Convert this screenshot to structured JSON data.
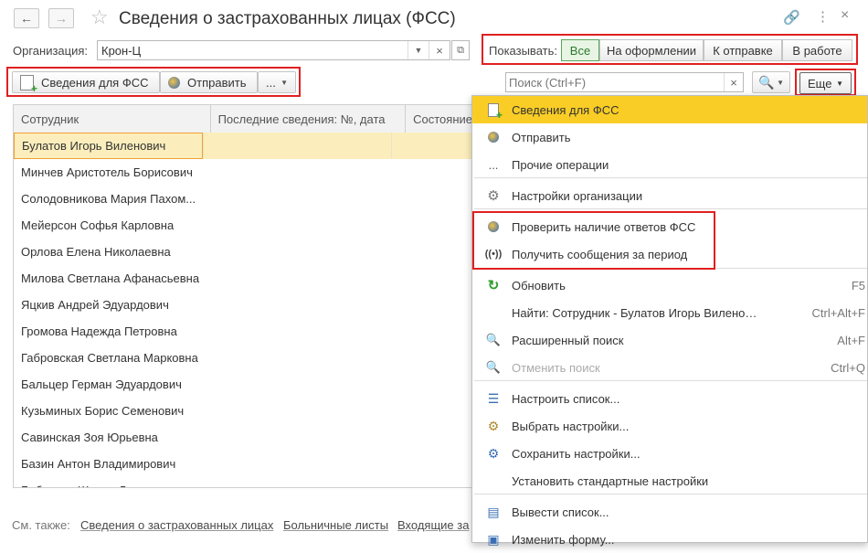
{
  "window": {
    "title": "Сведения о застрахованных лицах (ФСС)"
  },
  "org": {
    "label": "Организация:",
    "value": "Крон-Ц"
  },
  "show": {
    "label": "Показывать:",
    "options": [
      "Все",
      "На оформлении",
      "К отправке",
      "В работе"
    ],
    "active": "Все"
  },
  "toolbar": {
    "create_label": "Сведения для ФСС",
    "send_label": "Отправить",
    "more_label": "..."
  },
  "search": {
    "placeholder": "Поиск (Ctrl+F)",
    "clear": "×"
  },
  "more_button": {
    "label": "Еще"
  },
  "grid": {
    "headers": [
      "Сотрудник",
      "Последние сведения: №, дата",
      "Состояние"
    ],
    "rows": [
      "Булатов Игорь Виленович",
      "Минчев Аристотель Борисович",
      "Солодовникова Мария Пахом...",
      "Мейерсон Софья Карловна",
      "Орлова Елена Николаевна",
      "Милова Светлана Афанасьевна",
      "Яцкив Андрей Эдуардович",
      "Громова Надежда Петровна",
      "Габровская Светлана Марковна",
      "Бальцер Герман Эдуардович",
      "Кузьминых Борис Семенович",
      "Савинская Зоя Юрьевна",
      "Базин Антон Владимирович",
      "Бабичева Жанна Л..."
    ]
  },
  "menu": {
    "items": [
      {
        "label": "Сведения для ФСС",
        "icon": "add-doc-icon",
        "shortcut": ""
      },
      {
        "label": "Отправить",
        "icon": "send-globe-icon",
        "shortcut": ""
      },
      {
        "label": "Прочие операции",
        "icon": "ellipsis-icon",
        "shortcut": ""
      },
      {
        "label": "Настройки организации",
        "icon": "gear-icon",
        "shortcut": ""
      },
      {
        "label": "Проверить наличие ответов ФСС",
        "icon": "check-globe-icon",
        "shortcut": ""
      },
      {
        "label": "Получить сообщения за период",
        "icon": "broadcast-icon",
        "shortcut": ""
      },
      {
        "label": "Обновить",
        "icon": "refresh-icon",
        "shortcut": "F5"
      },
      {
        "label": "Найти: Сотрудник - Булатов Игорь Вилено…",
        "icon": "",
        "shortcut": "Ctrl+Alt+F"
      },
      {
        "label": "Расширенный поиск",
        "icon": "search-icon",
        "shortcut": "Alt+F"
      },
      {
        "label": "Отменить поиск",
        "icon": "cancel-search-icon",
        "shortcut": "Ctrl+Q"
      },
      {
        "label": "Настроить список...",
        "icon": "list-settings-icon",
        "shortcut": ""
      },
      {
        "label": "Выбрать настройки...",
        "icon": "choose-settings-icon",
        "shortcut": ""
      },
      {
        "label": "Сохранить настройки...",
        "icon": "save-settings-icon",
        "shortcut": ""
      },
      {
        "label": "Установить стандартные настройки",
        "icon": "",
        "shortcut": ""
      },
      {
        "label": "Вывести список...",
        "icon": "print-list-icon",
        "shortcut": ""
      },
      {
        "label": "Изменить форму...",
        "icon": "form-icon",
        "shortcut": ""
      }
    ]
  },
  "footer": {
    "see_also": "См. также:",
    "links": [
      "Сведения о застрахованных лицах",
      "Больничные листы",
      "Входящие за"
    ]
  },
  "colors": {
    "highlight": "#f9cd25",
    "selected_row": "#fbeebc",
    "red_annotation": "#e02020",
    "active_green": "#5aa55a"
  }
}
